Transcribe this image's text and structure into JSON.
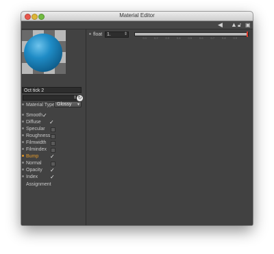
{
  "window": {
    "title": "Material Editor"
  },
  "toolbar": {
    "icons": [
      "arrow-left-icon",
      "arrow-up-icon",
      "lock-icon",
      "new-window-icon"
    ]
  },
  "material": {
    "name": "Oct tick 2",
    "type_label": "Material Type",
    "type_value": "Glossy"
  },
  "channels": [
    {
      "label": "Smooth",
      "checked": true
    },
    {
      "label": "Diffuse",
      "checked": true
    },
    {
      "label": "Specular",
      "checked": false
    },
    {
      "label": "Roughness",
      "checked": false
    },
    {
      "label": "Filmwidth",
      "checked": false
    },
    {
      "label": "Filmindex",
      "checked": false
    },
    {
      "label": "Bump",
      "checked": true,
      "active": true
    },
    {
      "label": "Normal",
      "checked": false
    },
    {
      "label": "Opacity",
      "checked": true
    },
    {
      "label": "Index",
      "checked": true
    }
  ],
  "assignment_label": "Assignment",
  "param": {
    "label": "float",
    "value": "1.",
    "slider_position": 1.0,
    "ticks": [
      "0.1",
      "0.2",
      "0.3",
      "0.4",
      "0.5",
      "0.6",
      "0.7",
      "0.8",
      "0.9"
    ]
  },
  "colors": {
    "accent_orange": "#e39a2a",
    "slider_marker": "#e03a2a",
    "sphere_blue": "#1f8cc6"
  }
}
